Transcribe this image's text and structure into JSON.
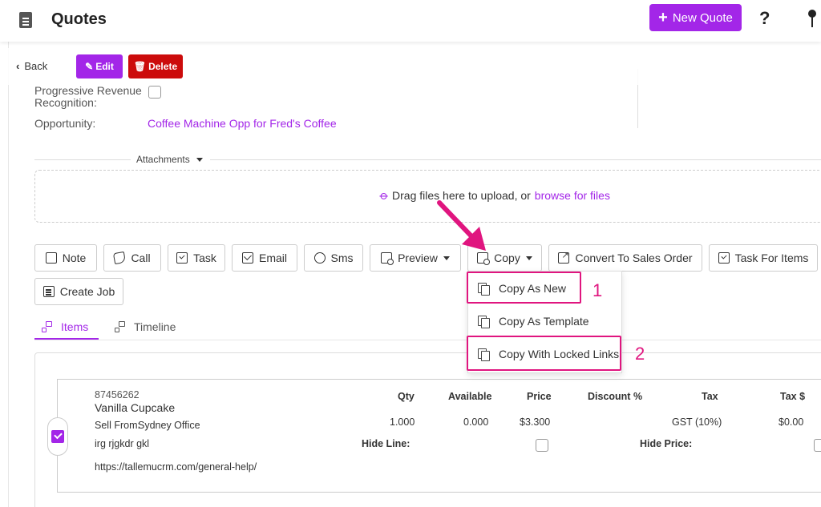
{
  "header": {
    "title": "Quotes",
    "new_quote_label": "New Quote",
    "help_glyph": "?"
  },
  "actions": {
    "back_label": "Back",
    "edit_label": "Edit",
    "delete_label": "Delete"
  },
  "fields": {
    "revenue_label_line1": "Progressive Revenue",
    "revenue_label_line2": "Recognition:",
    "opportunity_label": "Opportunity:",
    "opportunity_value": "Coffee Machine Opp for Fred's Coffee"
  },
  "attachments": {
    "label": "Attachments",
    "drop_text": "Drag files here to upload, or",
    "browse_link": "browse for files"
  },
  "toolbar": {
    "note": "Note",
    "call": "Call",
    "task": "Task",
    "email": "Email",
    "sms": "Sms",
    "preview": "Preview",
    "copy": "Copy",
    "convert": "Convert To Sales Order",
    "task_items": "Task For Items",
    "create_job": "Create Job"
  },
  "copy_menu": {
    "items": [
      {
        "label": "Copy As New"
      },
      {
        "label": "Copy As Template"
      },
      {
        "label": "Copy With Locked Links"
      }
    ],
    "annotations": [
      "1",
      "2"
    ],
    "annotation_color": "#e0157f"
  },
  "tabs": {
    "items": "Items",
    "timeline": "Timeline"
  },
  "line_item": {
    "code": "87456262",
    "name": "Vanilla Cupcake",
    "sell_from_label": "Sell From:",
    "sell_from_value": "Sydney Office",
    "description": "irg rjgkdr gkl",
    "url": "https://tallemucrm.com/general-help/",
    "headers": {
      "qty": "Qty",
      "available": "Available",
      "price": "Price",
      "discount": "Discount %",
      "tax": "Tax",
      "tax_amount": "Tax $"
    },
    "values": {
      "qty": "1.000",
      "available": "0.000",
      "price": "$3.300",
      "tax": "GST (10%)",
      "tax_amount": "$0.00"
    },
    "hide_line_label": "Hide Line:",
    "hide_price_label": "Hide Price:"
  },
  "colors": {
    "accent": "#a326e8",
    "danger": "#cc0b0b",
    "annotation": "#e0157f"
  }
}
